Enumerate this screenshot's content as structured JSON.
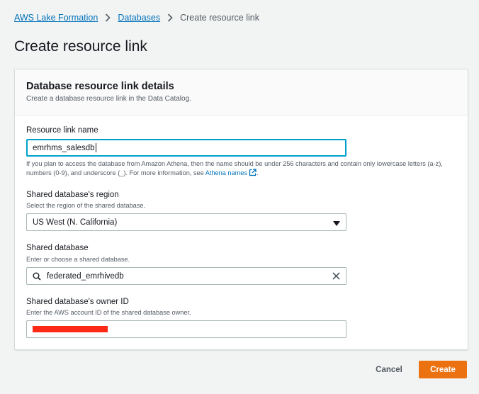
{
  "breadcrumb": {
    "items": [
      "AWS Lake Formation",
      "Databases"
    ],
    "current": "Create resource link"
  },
  "page": {
    "title": "Create resource link"
  },
  "panel": {
    "title": "Database resource link details",
    "description": "Create a database resource link in the Data Catalog."
  },
  "fields": {
    "resource_link_name": {
      "label": "Resource link name",
      "value": "emrhms_salesdb",
      "help_prefix": "If you plan to access the database from Amazon Athena, then the name should be under 256 characters and contain only lowercase letters (a-z), numbers (0-9), and underscore (_). For more information, see ",
      "help_link": "Athena names",
      "help_suffix": "."
    },
    "region": {
      "label": "Shared database's region",
      "description": "Select the region of the shared database.",
      "value": "US West (N. California)"
    },
    "shared_database": {
      "label": "Shared database",
      "description": "Enter or choose a shared database.",
      "value": "federated_emrhivedb"
    },
    "owner_id": {
      "label": "Shared database's owner ID",
      "description": "Enter the AWS account ID of the shared database owner."
    }
  },
  "actions": {
    "cancel": "Cancel",
    "create": "Create"
  },
  "colors": {
    "link": "#0073bb",
    "primary_button": "#ec7211",
    "focus_border": "#00a1c9",
    "redaction": "#ff2a16"
  }
}
